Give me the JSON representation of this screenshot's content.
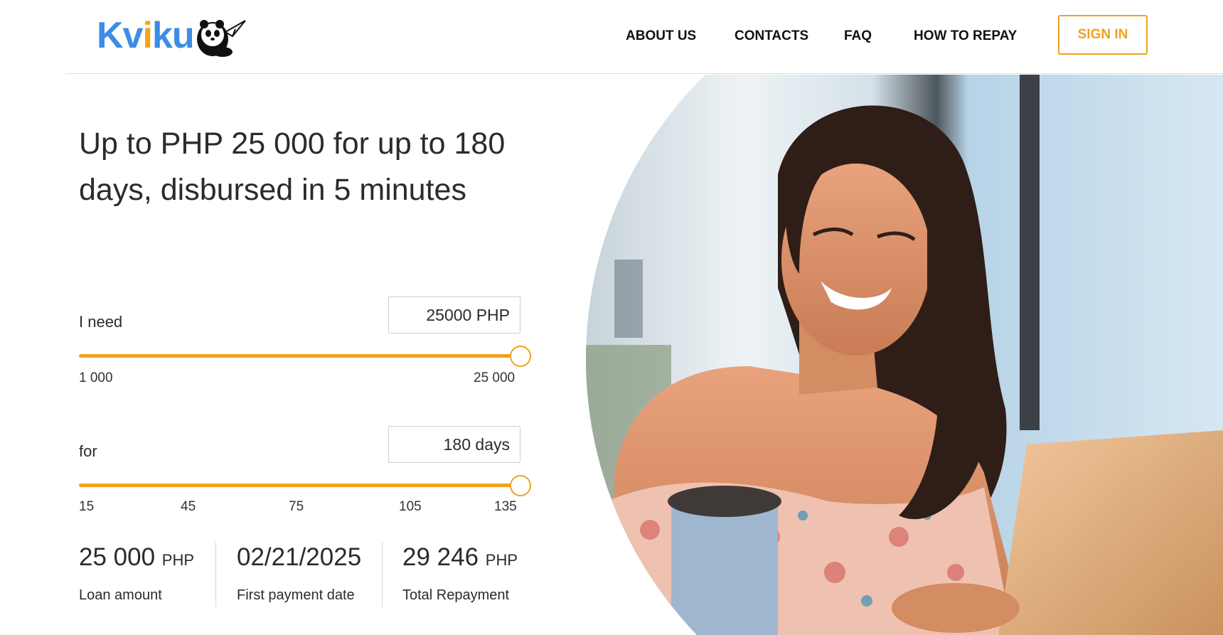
{
  "header": {
    "logo_text_pre": "Kv",
    "logo_text_i": "i",
    "logo_text_post": "ku",
    "nav": [
      {
        "label": "ABOUT US"
      },
      {
        "label": "CONTACTS"
      },
      {
        "label": "FAQ"
      },
      {
        "label": "HOW TO REPAY"
      }
    ],
    "sign_in": "SIGN IN"
  },
  "hero": {
    "headline": "Up to PHP 25 000 for up to 180 days, disbursed in 5 minutes"
  },
  "calculator": {
    "amount": {
      "label": "I need",
      "value": "25000 PHP",
      "min_label": "1 000",
      "max_label": "25 000",
      "fraction": 1.0
    },
    "term": {
      "label": "for",
      "value": "180 days",
      "ticks": [
        "15",
        "45",
        "75",
        "105",
        "135"
      ],
      "fraction": 1.0
    }
  },
  "summary": [
    {
      "value": "25 000",
      "unit": "PHP",
      "label": "Loan amount"
    },
    {
      "value": "02/21/2025",
      "unit": "",
      "label": "First payment date"
    },
    {
      "value": "29 246",
      "unit": "PHP",
      "label": "Total Repayment"
    }
  ],
  "colors": {
    "accent": "#f0a21e",
    "logo_blue": "#3d8de6",
    "text": "#2b2b2b"
  }
}
